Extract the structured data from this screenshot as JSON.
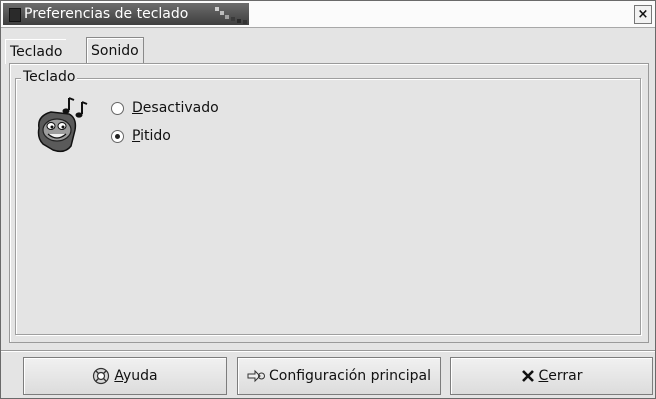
{
  "window": {
    "title": "Preferencias de teclado",
    "close_glyph": "×"
  },
  "tabs": [
    {
      "label": "Teclado",
      "selected": false
    },
    {
      "label": "Sonido",
      "selected": true
    }
  ],
  "group": {
    "legend": "Teclado",
    "icon": "speaker-music-icon",
    "options": [
      {
        "label": "Desactivado",
        "checked": false
      },
      {
        "label": "Pitido",
        "checked": true
      }
    ]
  },
  "buttons": {
    "help": {
      "label": "Ayuda",
      "icon": "help-lifebuoy-icon"
    },
    "main_config": {
      "label": "Configuración principal",
      "icon": "arrow-icon"
    },
    "close": {
      "label": "Cerrar",
      "icon": "x-icon"
    }
  }
}
